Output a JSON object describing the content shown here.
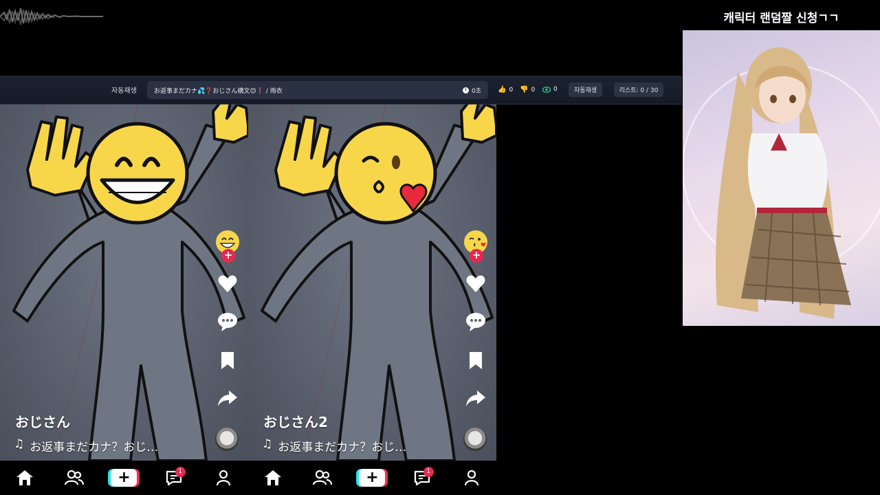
{
  "topbar": {
    "autoplay_label": "자동재생",
    "now_playing": "お返事まだカナ💦❓おじさん構文😊❗ / 雨衣",
    "time": "0초",
    "likes": "0",
    "dislikes": "0",
    "views": "0",
    "autoplay_button": "자동재생",
    "list_button": "리스트: 0 / 30"
  },
  "panels": [
    {
      "username": "おじさん",
      "song": "お返事まだカナ？おじ…",
      "emoji": "grinning-face"
    },
    {
      "username": "おじさん2",
      "song": "お返事まだカナ？おじ…",
      "emoji": "kissing-face"
    }
  ],
  "nav": {
    "inbox_count": "1"
  },
  "side": {
    "banner": "캐릭터 랜덤짤 신청ㄱㄱ"
  },
  "colors": {
    "accent_red": "#e8294f",
    "accent_cyan": "#2de0e6",
    "emoji_yellow": "#f7d64a"
  }
}
